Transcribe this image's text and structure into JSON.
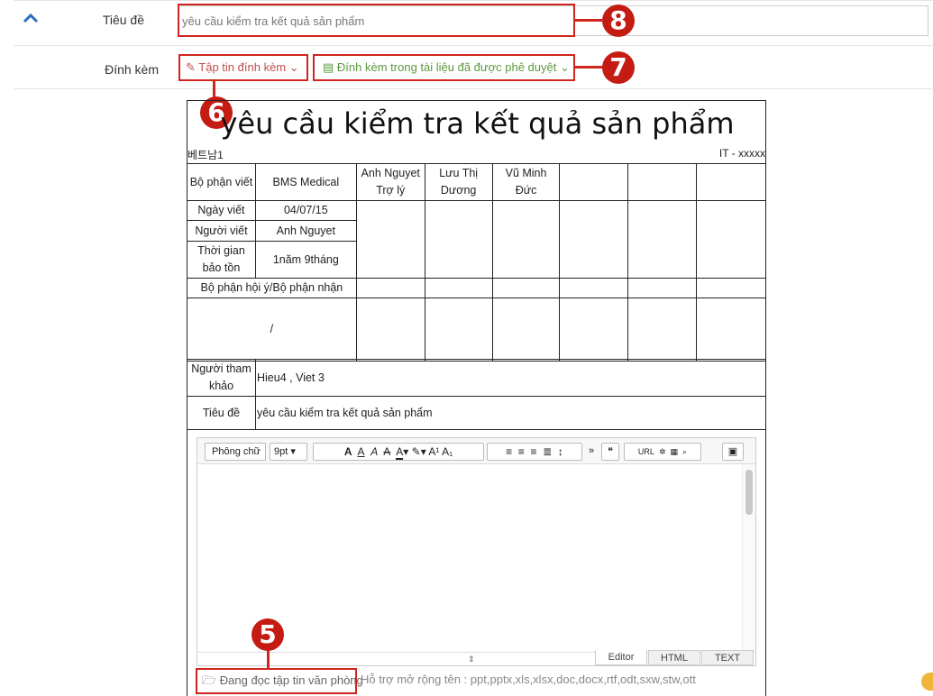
{
  "form": {
    "title_label": "Tiêu đề",
    "title_value": "yêu cầu kiểm tra kết quả sản phẩm",
    "attach_label": "Đính kèm",
    "attach_file_btn": "Tập tin đính kèm",
    "attach_approved_btn": "Đính kèm trong tài liệu đã được phê duyệt"
  },
  "callouts": [
    "8",
    "6",
    "7",
    "5"
  ],
  "doc": {
    "title": "yêu cầu kiểm tra kết quả sản phẩm",
    "left_code": "베트남1",
    "right_code": "IT - xxxxx",
    "dept_label": "Bộ phận viết",
    "dept_value": "BMS Medical",
    "date_label": "Ngày viết",
    "date_value": "04/07/15",
    "writer_label": "Người viết",
    "writer_value": "Anh Nguyet",
    "retention_label": "Thời gian bảo tồn",
    "retention_value": "1năm 9tháng",
    "approvers": [
      "Anh Nguyet Trợ lý",
      "Lưu Thị Dương",
      "Vũ Minh Đức",
      "",
      "",
      ""
    ],
    "cc_label": "Bộ phận hội ý/Bộ phận nhận",
    "cc_value": "/",
    "ref_label": "Người tham khảo",
    "ref_value": "Hieu4 , Viet 3",
    "subject_label": "Tiêu đề",
    "subject_value": "yêu cầu kiểm tra kết quả sản phẩm"
  },
  "editor": {
    "font_select": "Phông chữ",
    "size_select": "9pt",
    "modes": [
      "Editor",
      "HTML",
      "TEXT"
    ]
  },
  "footer": {
    "office_btn": "Đang đọc tập tin văn phòng",
    "support_hint": "Hỗ trợ mở rộng tên : ppt,pptx,xls,xlsx,doc,docx,rtf,odt,sxw,stw,ott"
  },
  "colors": {
    "accent_red": "#d0251f",
    "attach_file": "#c0504d",
    "attach_approved": "#5a9a3c",
    "collapse": "#2a6ebb"
  }
}
